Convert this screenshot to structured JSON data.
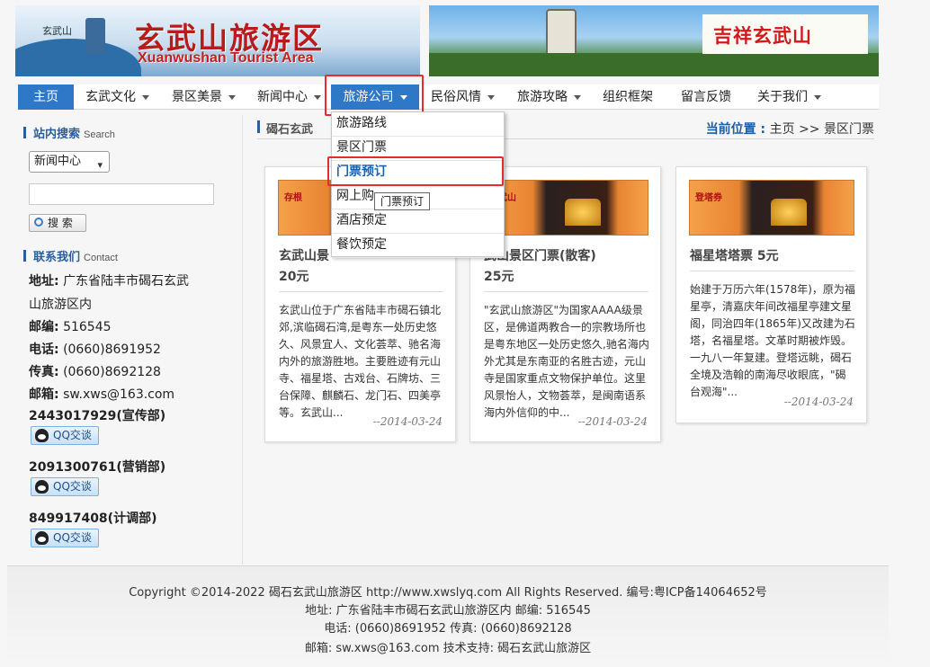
{
  "banner": {
    "logo_small": "玄武山",
    "title_cn": "玄武山旅游区",
    "title_en": "Xuanwushan Tourist Area",
    "slogan": "吉祥玄武山"
  },
  "nav": {
    "items": [
      {
        "label": "主页"
      },
      {
        "label": "玄武文化"
      },
      {
        "label": "景区美景"
      },
      {
        "label": "新闻中心"
      },
      {
        "label": "旅游公司"
      },
      {
        "label": "民俗风情"
      },
      {
        "label": "旅游攻略"
      },
      {
        "label": "组织框架"
      },
      {
        "label": "留言反馈"
      },
      {
        "label": "关于我们"
      }
    ]
  },
  "dropdown": {
    "items": [
      "旅游路线",
      "景区门票",
      "门票预订",
      "网上购",
      "酒店预定",
      "餐饮预定"
    ],
    "tooltip": "门票预订"
  },
  "sidebar": {
    "search_title": "站内搜索",
    "search_title_en": "Search",
    "select_value": "新闻中心",
    "search_button": "搜 索",
    "contact_title": "联系我们",
    "contact_title_en": "Contact",
    "address_label": "地址:",
    "address_line1": "广东省陆丰市碣石玄武",
    "address_line2": "山旅游区内",
    "zip_label": "邮编:",
    "zip": "516545",
    "phone_label": "电话:",
    "phone": "(0660)8691952",
    "fax_label": "传真:",
    "fax": "(0660)8692128",
    "email_label": "邮箱:",
    "email": "sw.xws@163.com",
    "qq": [
      {
        "label": "2443017929(宣传部)",
        "button": "QQ交谈"
      },
      {
        "label": "2091300761(营销部)",
        "button": "QQ交谈"
      },
      {
        "label": "849917408(计调部)",
        "button": "QQ交谈"
      }
    ]
  },
  "main": {
    "section_title": "碣石玄武",
    "location_label": "当前位置 :",
    "location_path": "主页 >> 景区门票",
    "cards": [
      {
        "thumb_label": "存根",
        "title_line1": "玄武山景",
        "title_line2": "20元",
        "desc": "玄武山位于广东省陆丰市碣石镇北郊,滨临碣石湾,是粤东一处历史悠久、风景宜人、文化荟萃、驰名海内外的旅游胜地。主要胜迹有元山寺、福星塔、古戏台、石牌坊、三台保障、麒麟石、龙门石、四美亭等。玄武山...",
        "date": "--2014-03-24"
      },
      {
        "thumb_label": "玄武山",
        "title_line1": "武山景区门票(散客)",
        "title_line2": "25元",
        "desc": "\"玄武山旅游区\"为国家AAAA级景区，是佛道两教合一的宗教场所也是粤东地区一处历史悠久,驰名海内外尤其是东南亚的名胜古迹，元山寺是国家重点文物保护单位。这里风景怡人，文物荟萃，是闽南语系海内外信仰的中...",
        "date": "--2014-03-24"
      },
      {
        "thumb_label": "登塔券",
        "title_line1": "福星塔塔票 5元",
        "title_line2": "",
        "desc": "始建于万历六年(1578年)，原为福星亭，清嘉庆年间改福星亭建文星阁，同治四年(1865年)又改建为石塔，名福星塔。文革时期被炸毁。一九八一年复建。登塔远眺，碣石全境及浩翰的南海尽收眼底，\"碣台观海\"...",
        "date": "--2014-03-24"
      }
    ]
  },
  "footer": {
    "line1": "Copyright ©2014-2022 碣石玄武山旅游区 http://www.xwslyq.com All Rights Reserved. 编号:粤ICP备14064652号",
    "line2": "地址: 广东省陆丰市碣石玄武山旅游区内    邮编: 516545",
    "line3": "电话: (0660)8691952    传真: (0660)8692128",
    "line4": "邮箱: sw.xws@163.com    技术支持: 碣石玄武山旅游区"
  },
  "colors": {
    "accent": "#2f78c8",
    "highlight": "#e52b2b",
    "title_red": "#b91a1a"
  }
}
